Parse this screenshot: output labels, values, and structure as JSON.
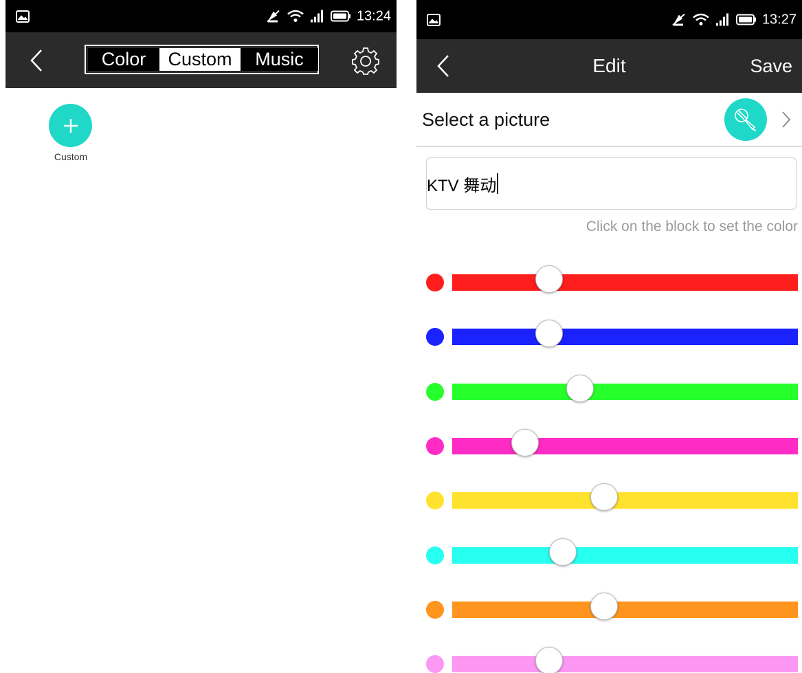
{
  "left_screen": {
    "status_bar": {
      "time": "13:24"
    },
    "tabs": [
      {
        "label": "Color",
        "selected": true
      },
      {
        "label": "Custom",
        "selected": false
      },
      {
        "label": "Music",
        "selected": true
      }
    ],
    "add_item": {
      "label": "Custom"
    }
  },
  "right_screen": {
    "status_bar": {
      "time": "13:27"
    },
    "header": {
      "title": "Edit",
      "save_label": "Save"
    },
    "picture_row": {
      "label": "Select a picture"
    },
    "name_input": {
      "value": "KTV 舞动"
    },
    "hint": "Click on the block to set the color",
    "color_sliders": [
      {
        "name": "red",
        "color": "#ff1e1e",
        "value": 0.28
      },
      {
        "name": "blue",
        "color": "#1a22ff",
        "value": 0.28
      },
      {
        "name": "green",
        "color": "#27ff2d",
        "value": 0.37
      },
      {
        "name": "magenta",
        "color": "#ff2bc5",
        "value": 0.21
      },
      {
        "name": "yellow",
        "color": "#ffe22d",
        "value": 0.44
      },
      {
        "name": "cyan",
        "color": "#27fff0",
        "value": 0.32
      },
      {
        "name": "orange",
        "color": "#ff951e",
        "value": 0.44
      },
      {
        "name": "pink",
        "color": "#fc97f4",
        "value": 0.28
      }
    ]
  },
  "accent_color": "#1fd8c8"
}
